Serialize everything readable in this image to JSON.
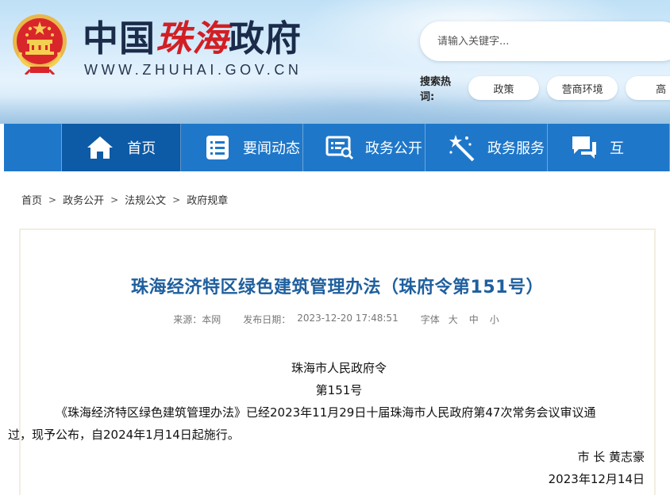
{
  "header": {
    "title_part1": "中国",
    "title_part2": "珠海",
    "title_part3": "政府",
    "url": "WWW.ZHUHAI.GOV.CN",
    "search_placeholder": "请输入关键字...",
    "hot_label": "搜索热词:",
    "hot_tags": [
      "政策",
      "营商环境",
      "高"
    ]
  },
  "nav": {
    "items": [
      {
        "label": "首页",
        "icon": "home-icon"
      },
      {
        "label": "要闻动态",
        "icon": "news-list-icon"
      },
      {
        "label": "政务公开",
        "icon": "open-affairs-icon"
      },
      {
        "label": "政务服务",
        "icon": "magic-wand-icon"
      },
      {
        "label": "互",
        "icon": "chat-icon"
      }
    ]
  },
  "breadcrumb": [
    "首页",
    "政务公开",
    "法规公文",
    "政府规章"
  ],
  "article": {
    "title": "珠海经济特区绿色建筑管理办法（珠府令第151号）",
    "source_label": "来源：本网",
    "date_label": "发布日期：",
    "date_value": "2023-12-20 17:48:51",
    "font_label": "字体",
    "font_sizes": [
      "大",
      "中",
      "小"
    ],
    "line1": "珠海市人民政府令",
    "line2": "第151号",
    "para1_line1": "《珠海经济特区绿色建筑管理办法》已经2023年11月29日十届珠海市人民政府第47次常务会议审议通",
    "para1_line2": "过，现予公布，自2024年1月14日起施行。",
    "signature": "市 长 黄志豪",
    "sign_date": "2023年12月14日"
  },
  "colors": {
    "nav_bg": "#1f77c9",
    "nav_active": "#0d5aa6",
    "title_blue": "#1f5f9e",
    "logo_red": "#d11f24"
  }
}
